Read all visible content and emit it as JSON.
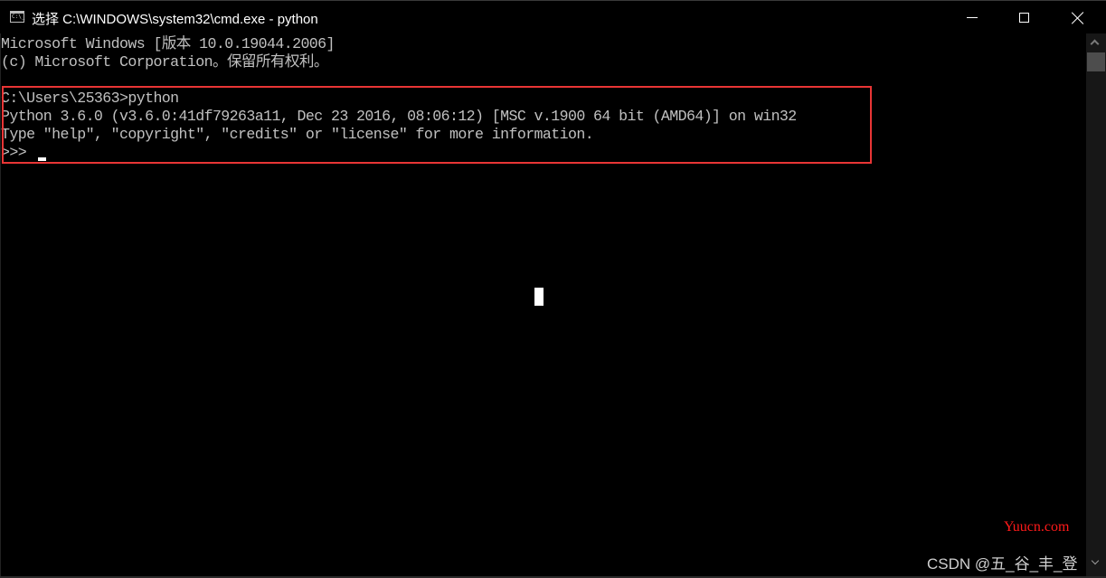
{
  "window": {
    "title": "选择 C:\\WINDOWS\\system32\\cmd.exe - python",
    "icon": "cmd-icon",
    "icon_text": "C:\\_",
    "controls": {
      "minimize": "minimize-icon",
      "maximize": "maximize-icon",
      "close": "close-icon"
    }
  },
  "console": {
    "lines": [
      "Microsoft Windows [版本 10.0.19044.2006]",
      "(c) Microsoft Corporation。保留所有权利。",
      "",
      "C:\\Users\\25363>python",
      "Python 3.6.0 (v3.6.0:41df79263a11, Dec 23 2016, 08:06:12) [MSC v.1900 64 bit (AMD64)] on win32",
      "Type \"help\", \"copyright\", \"credits\" or \"license\" for more information.",
      ">>> "
    ],
    "text_color": "#c0c0c0",
    "background": "#000000",
    "highlight_color": "#e83535"
  },
  "watermarks": {
    "site": "Yuucn.com",
    "author": "CSDN @五_谷_丰_登"
  },
  "colors": {
    "site_watermark": "#ff1a1a"
  }
}
